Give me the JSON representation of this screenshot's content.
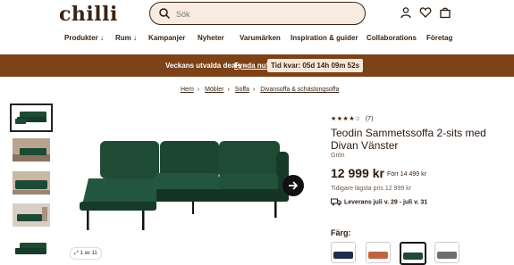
{
  "brand": {
    "logo": "chilli"
  },
  "search": {
    "placeholder": "Sök"
  },
  "nav": {
    "items": [
      "Produkter",
      "Rum",
      "Kampanjer",
      "Nyheter",
      "Varumärken",
      "Inspiration & guider",
      "Collaborations",
      "Företag"
    ]
  },
  "promo": {
    "text": "Veckans utvalda deals -",
    "link": "Fynda nu!",
    "timer": "Tid kvar: 05d 14h 09m 52s"
  },
  "breadcrumb": [
    "Hem",
    "Möbler",
    "Soffa",
    "Divansoffa & schäslongsoffa"
  ],
  "gallery": {
    "counter": "1 av 11"
  },
  "product": {
    "rating_count": "(7)",
    "rating_value": 4,
    "title": "Teodin Sammetssoffa 2-sits med Divan Vänster",
    "color_name": "Grön",
    "price": "12 999 kr",
    "old_price": "Förr 14 499 kr",
    "lowest_price": "Tidigare lägsta pris 12 999 kr",
    "delivery": "Leverans juli v. 29 - juli v. 31",
    "color_label": "Färg:"
  },
  "colors": {
    "sofa_green": "#1e4a34",
    "brand_brown": "#7c4218",
    "search_bg": "#f8ece2"
  }
}
